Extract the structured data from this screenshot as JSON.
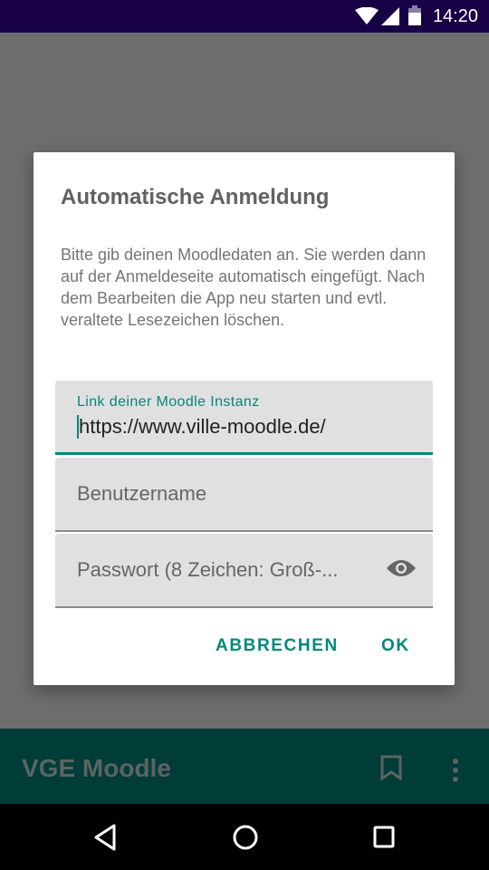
{
  "status_bar": {
    "time": "14:20"
  },
  "app_bar": {
    "title": "VGE Moodle"
  },
  "dialog": {
    "title": "Automatische Anmeldung",
    "message": "Bitte gib deinen Moodledaten an. Sie werden dann auf der Anmeldeseite automatisch eingefügt. Nach dem Bearbeiten die App neu starten und evtl. veraltete Lesezeichen löschen.",
    "fields": {
      "link": {
        "label": "Link deiner Moodle Instanz",
        "value": "https://www.ville-moodle.de/"
      },
      "username": {
        "placeholder": "Benutzername"
      },
      "password": {
        "placeholder": "Passwort (8 Zeichen: Groß-..."
      }
    },
    "buttons": {
      "cancel": "ABBRECHEN",
      "ok": "OK"
    }
  },
  "colors": {
    "accent": "#00897b",
    "status_bar": "#170046",
    "toolbar": "#003d38"
  }
}
